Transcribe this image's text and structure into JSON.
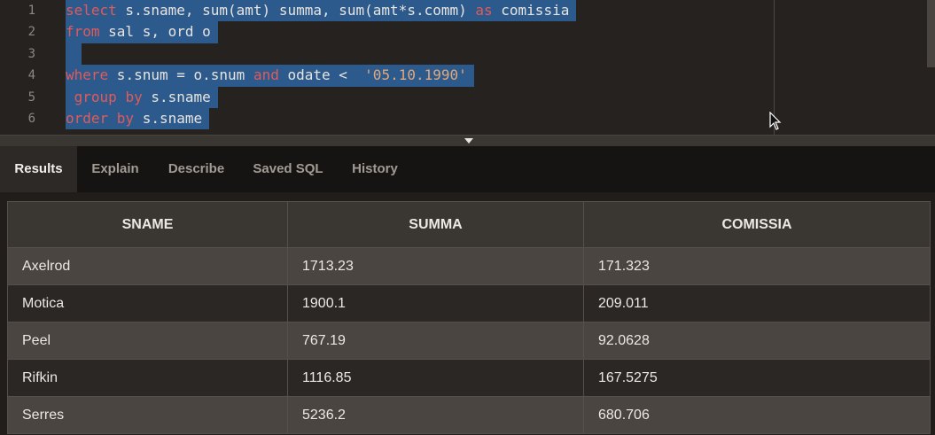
{
  "editor": {
    "line_numbers": [
      "1",
      "2",
      "3",
      "4",
      "5",
      "6"
    ],
    "lines": [
      [
        {
          "t": "select",
          "c": "kw"
        },
        {
          "t": " s.sname, sum(amt) summa, sum(amt*s.comm) ",
          "c": "plain"
        },
        {
          "t": "as",
          "c": "kw"
        },
        {
          "t": " comissia",
          "c": "plain"
        }
      ],
      [
        {
          "t": "from",
          "c": "kw"
        },
        {
          "t": " sal s, ord o",
          "c": "plain"
        }
      ],
      [
        {
          "t": " ",
          "c": "plain"
        }
      ],
      [
        {
          "t": "where",
          "c": "kw"
        },
        {
          "t": " s.snum = o.snum ",
          "c": "plain"
        },
        {
          "t": "and",
          "c": "kw"
        },
        {
          "t": " odate <  ",
          "c": "plain"
        },
        {
          "t": "'05.10.1990'",
          "c": "str"
        }
      ],
      [
        {
          "t": " ",
          "c": "plain"
        },
        {
          "t": "group by",
          "c": "kw"
        },
        {
          "t": " s.sname",
          "c": "plain"
        }
      ],
      [
        {
          "t": "order by",
          "c": "kw"
        },
        {
          "t": " s.sname",
          "c": "plain"
        }
      ]
    ]
  },
  "tabs": [
    {
      "label": "Results",
      "active": true
    },
    {
      "label": "Explain",
      "active": false
    },
    {
      "label": "Describe",
      "active": false
    },
    {
      "label": "Saved SQL",
      "active": false
    },
    {
      "label": "History",
      "active": false
    }
  ],
  "results": {
    "columns": [
      "SNAME",
      "SUMMA",
      "COMISSIA"
    ],
    "rows": [
      [
        "Axelrod",
        "1713.23",
        "171.323"
      ],
      [
        "Motica",
        "1900.1",
        "209.011"
      ],
      [
        "Peel",
        "767.19",
        "92.0628"
      ],
      [
        "Rifkin",
        "1116.85",
        "167.5275"
      ],
      [
        "Serres",
        "5236.2",
        "680.706"
      ]
    ]
  }
}
